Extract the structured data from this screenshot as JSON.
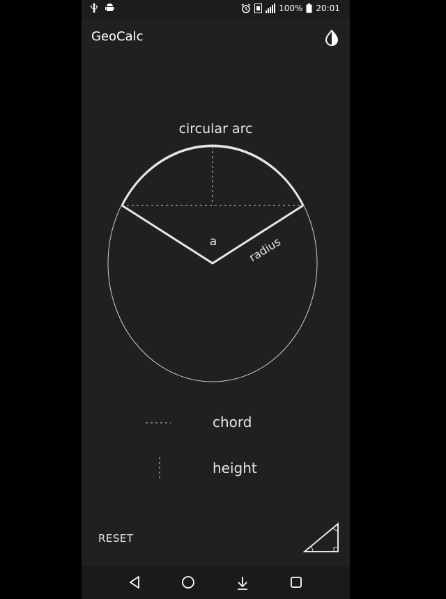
{
  "status_bar": {
    "battery": "100%",
    "time": "20:01",
    "icons": [
      "usb-icon",
      "android-debug-icon",
      "alarm-icon",
      "sim-icon",
      "signal-icon",
      "battery-icon"
    ]
  },
  "app_bar": {
    "title": "GeoCalc",
    "theme_icon": "theme-toggle-icon"
  },
  "diagram": {
    "title": "circular arc",
    "angle_label": "a",
    "radius_label": "radius"
  },
  "legend": [
    {
      "label": "chord",
      "style": "dashed-horizontal"
    },
    {
      "label": "height",
      "style": "dashed-vertical"
    }
  ],
  "footer": {
    "reset_label": "RESET",
    "triangle_icon": "right-triangle-icon"
  },
  "nav_bar": {
    "icons": [
      "back-icon",
      "home-icon",
      "download-icon",
      "recents-icon"
    ]
  },
  "colors": {
    "background": "#202020",
    "stroke": "#e6e6e6",
    "text": "#e6e6e6"
  }
}
